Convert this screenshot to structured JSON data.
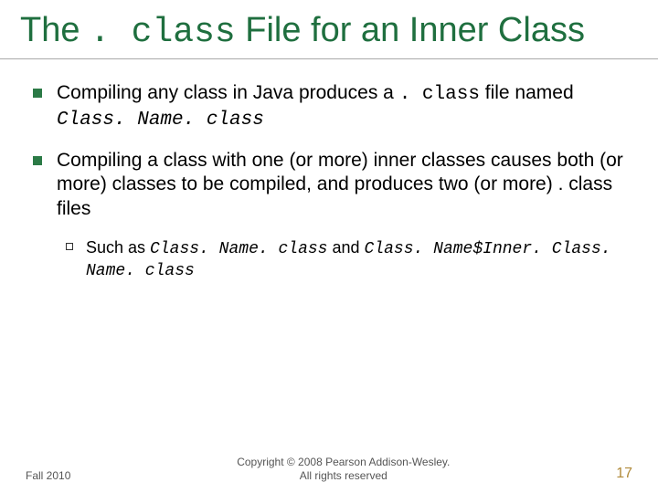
{
  "title": {
    "pre": "The ",
    "code": ". class",
    "post": " File for an Inner Class"
  },
  "bullets": [
    {
      "seg1": "Compiling any class in Java produces a ",
      "code1": ". class",
      "seg2": " file named ",
      "code2": "Class. Name. class"
    },
    {
      "seg1": "Compiling a class with one (or more) inner classes causes both (or more) classes to be compiled, and produces two (or more) . class files"
    }
  ],
  "subbullet": {
    "seg1": "Such as ",
    "code1": "Class. Name. class",
    "seg2": " and ",
    "code2": "Class. Name$Inner. Class. Name. class"
  },
  "footer": {
    "left": "Fall 2010",
    "center_line1": "Copyright © 2008 Pearson Addison-Wesley.",
    "center_line2": "All rights reserved",
    "right": "17"
  }
}
